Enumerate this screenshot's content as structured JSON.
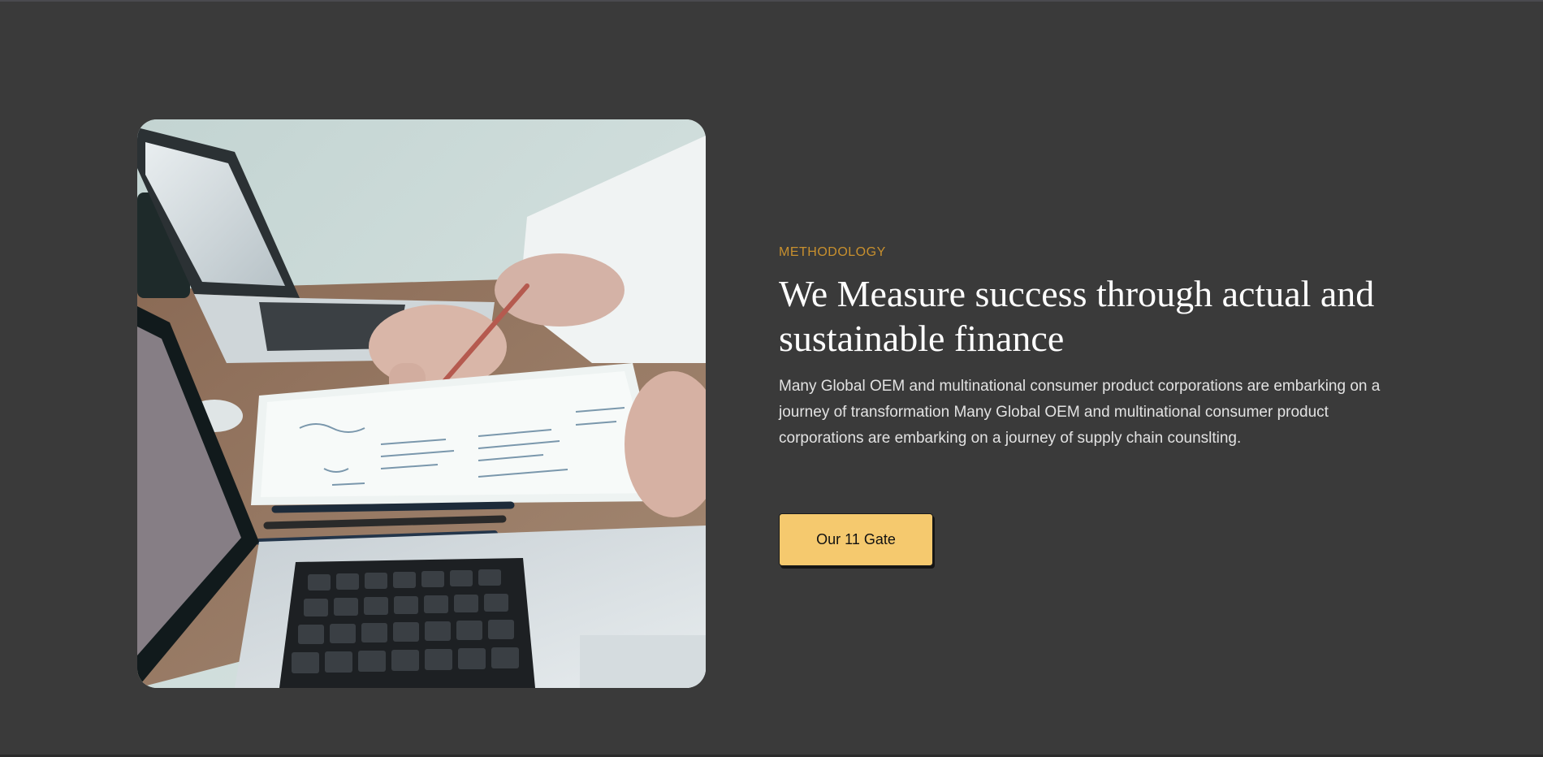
{
  "section": {
    "eyebrow": "METHODOLOGY",
    "heading": "We Measure success through actual and sustainable finance",
    "body": "Many Global OEM and multinational consumer product corporations are embarking on a journey of transformation Many Global OEM and multinational consumer product corporations are embarking on a journey of supply chain counslting.",
    "cta_label": "Our 11 Gate"
  },
  "colors": {
    "background": "#3a3a3a",
    "accent": "#c8902e",
    "button": "#f5c96e",
    "heading": "#ffffff"
  },
  "image": {
    "subject": "business-meeting-photo"
  }
}
